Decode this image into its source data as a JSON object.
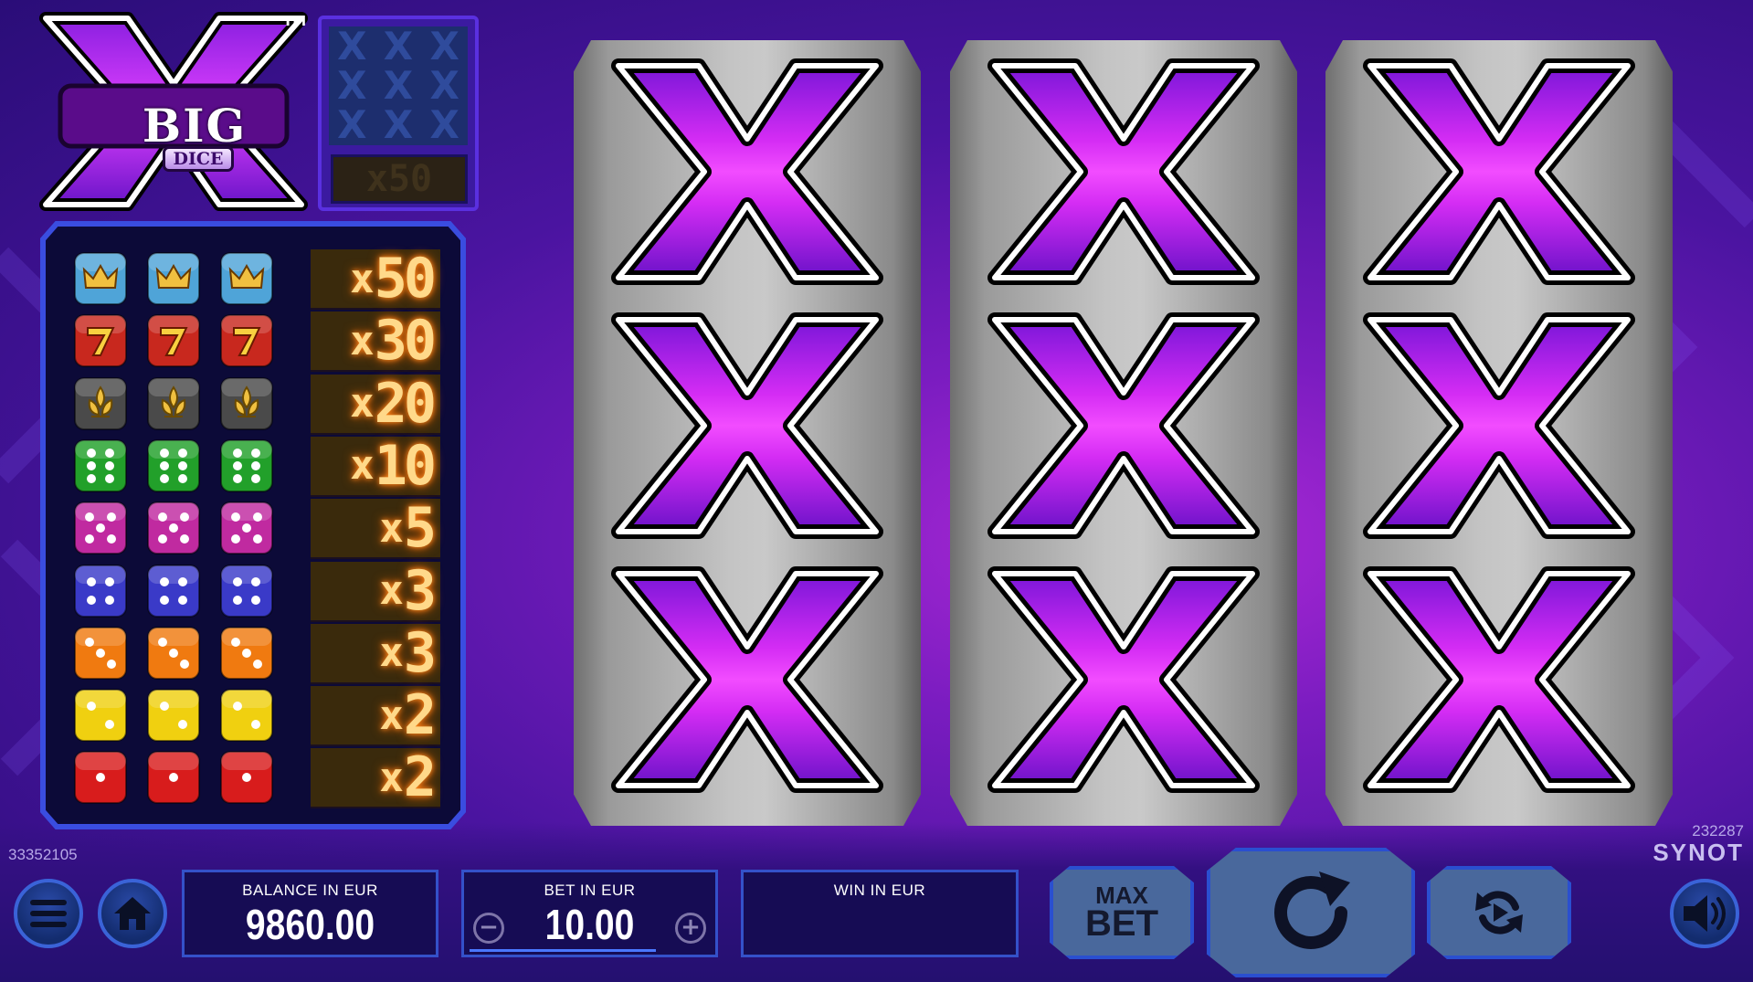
{
  "logo": {
    "main": "BIG",
    "sub": "DICE",
    "tm": "TM"
  },
  "mini_preview": {
    "symbols": [
      "X",
      "X",
      "X",
      "X",
      "X",
      "X",
      "X",
      "X",
      "X"
    ],
    "multiplier": "x50"
  },
  "paytable": [
    {
      "symbol": "crown-die",
      "multiplier": "50"
    },
    {
      "symbol": "seven-die",
      "multiplier": "30"
    },
    {
      "symbol": "lily-die",
      "multiplier": "20"
    },
    {
      "symbol": "green-die",
      "multiplier": "10"
    },
    {
      "symbol": "pink-die",
      "multiplier": "5"
    },
    {
      "symbol": "blue-die",
      "multiplier": "3"
    },
    {
      "symbol": "orange-die",
      "multiplier": "3"
    },
    {
      "symbol": "yellow-die",
      "multiplier": "2"
    },
    {
      "symbol": "red-die",
      "multiplier": "2"
    }
  ],
  "paytable_x": "x",
  "reels": [
    [
      "big-x-symbol",
      "big-x-symbol",
      "big-x-symbol"
    ],
    [
      "big-x-symbol",
      "big-x-symbol",
      "big-x-symbol"
    ],
    [
      "big-x-symbol",
      "big-x-symbol",
      "big-x-symbol"
    ]
  ],
  "footer": {
    "game_id": "33352105",
    "build_id": "232287",
    "brand": "SYNOT",
    "balance_label": "BALANCE IN EUR",
    "balance_value": "9860.00",
    "bet_label": "BET IN EUR",
    "bet_value": "10.00",
    "bet_minus": "−",
    "bet_plus": "+",
    "win_label": "WIN IN EUR",
    "win_value": "",
    "maxbet_line1": "MAX",
    "maxbet_line2": "BET"
  },
  "icons": {
    "menu": "menu-icon",
    "home": "home-icon",
    "spin": "spin-icon",
    "autoplay": "autoplay-icon",
    "sound": "speaker-icon"
  },
  "colors": {
    "accent_purple": "#c026e8",
    "panel_border": "#3451c9",
    "multiplier_glow": "#ffd98a"
  }
}
